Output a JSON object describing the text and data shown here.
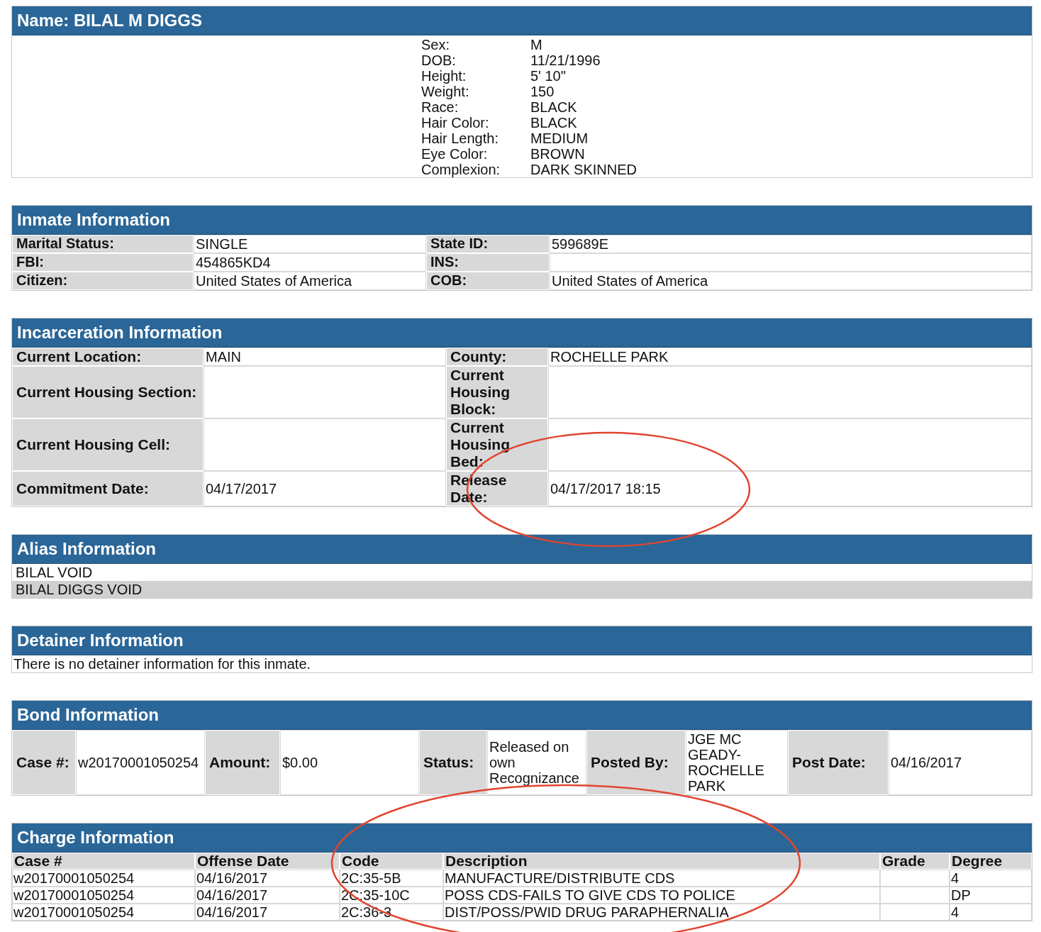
{
  "profile": {
    "title": "Name: BILAL M DIGGS",
    "fields": [
      {
        "label": "Sex:",
        "value": "M"
      },
      {
        "label": "DOB:",
        "value": "11/21/1996"
      },
      {
        "label": "Height:",
        "value": "5' 10\""
      },
      {
        "label": "Weight:",
        "value": "150"
      },
      {
        "label": "Race:",
        "value": "BLACK"
      },
      {
        "label": "Hair Color:",
        "value": "BLACK"
      },
      {
        "label": "Hair Length:",
        "value": "MEDIUM"
      },
      {
        "label": "Eye Color:",
        "value": "BROWN"
      },
      {
        "label": "Complexion:",
        "value": "DARK SKINNED"
      }
    ]
  },
  "inmate": {
    "title": "Inmate Information",
    "rows": [
      [
        {
          "label": "Marital Status:",
          "value": "SINGLE"
        },
        {
          "label": "State ID:",
          "value": "599689E"
        }
      ],
      [
        {
          "label": "FBI:",
          "value": "454865KD4"
        },
        {
          "label": "INS:"
        }
      ],
      [
        {
          "label": "Citizen:",
          "value": "United States of America"
        },
        {
          "label": "COB:",
          "value": "United States of America"
        }
      ]
    ]
  },
  "incarceration": {
    "title": "Incarceration Information",
    "rows": [
      [
        {
          "label": "Current Location:",
          "value": "MAIN"
        },
        {
          "label": "County:",
          "value": "ROCHELLE PARK"
        }
      ],
      [
        {
          "label": "Current Housing Section:"
        },
        {
          "label": "Current Housing Block:"
        }
      ],
      [
        {
          "label": "Current Housing Cell:"
        },
        {
          "label": "Current Housing Bed:"
        }
      ],
      [
        {
          "label": "Commitment Date:",
          "value": "04/17/2017"
        },
        {
          "label": "Release Date:",
          "value": "04/17/2017 18:15"
        }
      ]
    ]
  },
  "alias": {
    "title": "Alias Information",
    "names": [
      "BILAL VOID",
      "BILAL DIGGS VOID"
    ]
  },
  "detainer": {
    "title": "Detainer Information",
    "message": "There is no detainer information for this inmate."
  },
  "bond": {
    "title": "Bond Information",
    "fields": [
      {
        "label": "Case #:",
        "value": "w20170001050254"
      },
      {
        "label": "Amount:",
        "value": "$0.00"
      },
      {
        "label": "Status:",
        "value": "Released on own Recognizance"
      },
      {
        "label": "Posted By:",
        "value": "JGE MC GEADY-ROCHELLE PARK"
      },
      {
        "label": "Post Date:",
        "value": "04/16/2017"
      }
    ]
  },
  "charges": {
    "title": "Charge Information",
    "columns": [
      "Case #",
      "Offense Date",
      "Code",
      "Description",
      "Grade",
      "Degree"
    ],
    "rows": [
      {
        "case": "w20170001050254",
        "offense_date": "04/16/2017",
        "code": "2C:35-5B",
        "description": "MANUFACTURE/DISTRIBUTE CDS",
        "degree": "4"
      },
      {
        "case": "w20170001050254",
        "offense_date": "04/16/2017",
        "code": "2C:35-10C",
        "description": "POSS CDS-FAILS TO GIVE CDS TO POLICE",
        "degree": "DP"
      },
      {
        "case": "w20170001050254",
        "offense_date": "04/16/2017",
        "code": "2C:36-3",
        "description": "DIST/POSS/PWID DRUG PARAPHERNALIA",
        "degree": "4"
      }
    ]
  }
}
